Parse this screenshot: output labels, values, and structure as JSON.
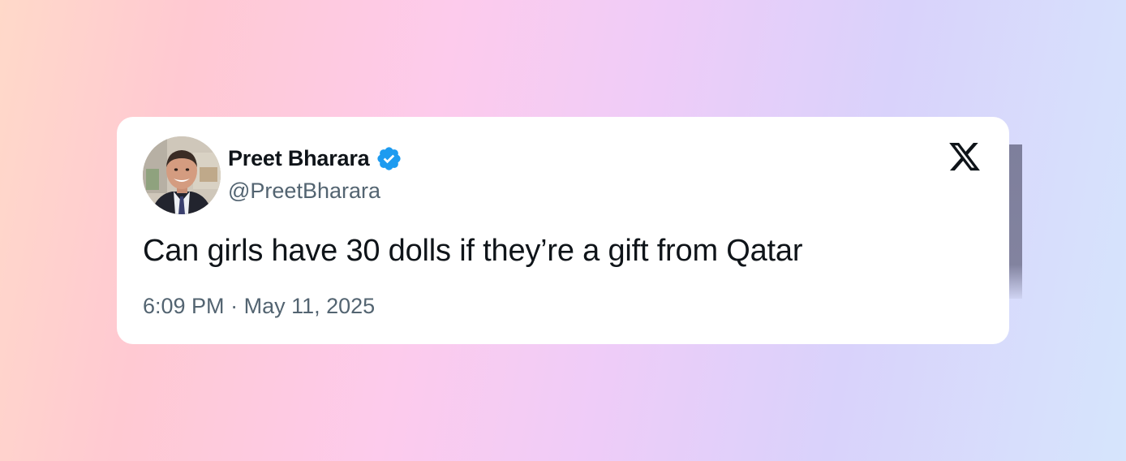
{
  "tweet": {
    "author_name": "Preet Bharara",
    "handle": "@PreetBharara",
    "verified": true,
    "text": "Can girls have 30 dolls if they’re a gift from Qatar",
    "time": "6:09 PM",
    "separator": "·",
    "date": "May 11, 2025"
  },
  "icons": {
    "verified": "verified-badge-icon",
    "platform": "x-logo-icon"
  },
  "colors": {
    "verified_blue": "#1d9bf0",
    "text_primary": "#0f1419",
    "text_secondary": "#536471",
    "card_bg": "#ffffff"
  }
}
